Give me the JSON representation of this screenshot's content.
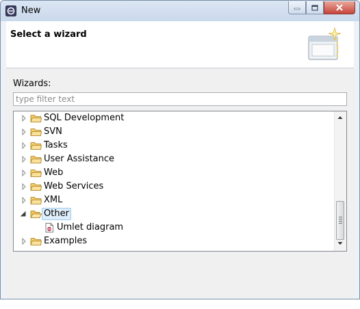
{
  "window": {
    "title": "New"
  },
  "header": {
    "title": "Select a wizard"
  },
  "wizards_label": "Wizards:",
  "filter": {
    "value": "",
    "placeholder": "type filter text"
  },
  "tree": {
    "items": [
      {
        "label": "SQL Development",
        "expanded": false,
        "icon": "folder-icon"
      },
      {
        "label": "SVN",
        "expanded": false,
        "icon": "folder-icon"
      },
      {
        "label": "Tasks",
        "expanded": false,
        "icon": "folder-icon"
      },
      {
        "label": "User Assistance",
        "expanded": false,
        "icon": "folder-icon"
      },
      {
        "label": "Web",
        "expanded": false,
        "icon": "folder-icon"
      },
      {
        "label": "Web Services",
        "expanded": false,
        "icon": "folder-icon"
      },
      {
        "label": "XML",
        "expanded": false,
        "icon": "folder-icon"
      },
      {
        "label": "Other",
        "expanded": true,
        "selected": true,
        "icon": "folder-open-icon"
      },
      {
        "label": "Umlet diagram",
        "icon": "umlet-diagram-icon"
      },
      {
        "label": "Examples",
        "expanded": false,
        "icon": "folder-icon"
      }
    ]
  },
  "colors": {
    "folder": "#f5cf66",
    "selection": "#dfeefb",
    "close_button": "#c7433a"
  }
}
